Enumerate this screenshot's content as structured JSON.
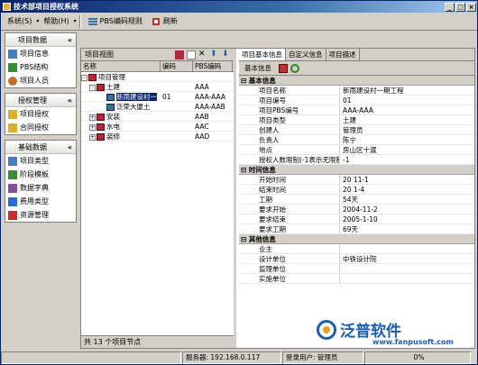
{
  "window": {
    "title": "技术部项目授权系统"
  },
  "menubar": {
    "system": "系统(S)",
    "help": "帮助(H)",
    "pbs_rules": "PBS编码规则",
    "refresh": "刷新"
  },
  "sidebar": {
    "groups": [
      {
        "title": "项目数据",
        "items": [
          "项目信息",
          "PBS结构",
          "项目人员"
        ]
      },
      {
        "title": "授权管理",
        "items": [
          "项目授权",
          "合同授权"
        ]
      },
      {
        "title": "基础数据",
        "items": [
          "项目类型",
          "阶段模板",
          "数据字典",
          "费用类型",
          "资源管理"
        ]
      }
    ]
  },
  "tree": {
    "title": "项目视图",
    "columns": [
      "名称",
      "编码",
      "PBS编码"
    ],
    "rows": [
      {
        "name": "项目管理",
        "code": "",
        "pbs": "",
        "expander": "-"
      },
      {
        "name": "土建",
        "code": "",
        "pbs": "AAA",
        "expander": "-"
      },
      {
        "name": "新雨建设村一",
        "code": "01",
        "pbs": "AAA-AAA",
        "expander": ""
      },
      {
        "name": "泛荣大厦土",
        "code": "",
        "pbs": "AAA-AAB",
        "expander": ""
      },
      {
        "name": "安装",
        "code": "",
        "pbs": "AAB",
        "expander": "+"
      },
      {
        "name": "水电",
        "code": "",
        "pbs": "AAC",
        "expander": "+"
      },
      {
        "name": "装修",
        "code": "",
        "pbs": "AAD",
        "expander": "+"
      }
    ],
    "footer": "共 13 个项目节点"
  },
  "details": {
    "tabs": [
      "项目基本信息",
      "自定义信息",
      "项目描述"
    ],
    "subtab": "基本信息",
    "sections": [
      {
        "title": "基本信息",
        "rows": [
          {
            "k": "项目名称",
            "v": "新雨建设村一期工程"
          },
          {
            "k": "项目编号",
            "v": "01"
          },
          {
            "k": "项目PBS编号",
            "v": "AAA-AAA"
          },
          {
            "k": "项目类型",
            "v": "土建"
          },
          {
            "k": "创建人",
            "v": "管理员"
          },
          {
            "k": "负责人",
            "v": "陈宁"
          },
          {
            "k": "地点",
            "v": "房山区十渡"
          },
          {
            "k": "授权人数限制(-1表示无限制)",
            "v": "-1"
          }
        ]
      },
      {
        "title": "时间信息",
        "rows": [
          {
            "k": "开始时间",
            "v": "20 11-1"
          },
          {
            "k": "结束时间",
            "v": "20 1-4"
          },
          {
            "k": "工期",
            "v": "54天"
          },
          {
            "k": "要求开始",
            "v": "2004-11-2"
          },
          {
            "k": "要求结束",
            "v": "2005-1-10"
          },
          {
            "k": "要求工期",
            "v": "69天"
          }
        ]
      },
      {
        "title": "其他信息",
        "rows": [
          {
            "k": "业主",
            "v": ""
          },
          {
            "k": "设计单位",
            "v": "中铁设计院"
          },
          {
            "k": "监理单位",
            "v": ""
          },
          {
            "k": "实施单位",
            "v": ""
          }
        ]
      }
    ]
  },
  "status": {
    "server": "服务器: 192.168.0.117",
    "user": "登录用户: 管理员",
    "progress": "0%"
  },
  "logo": {
    "text": "泛普软件",
    "url": "www.fanpusoft.com"
  }
}
